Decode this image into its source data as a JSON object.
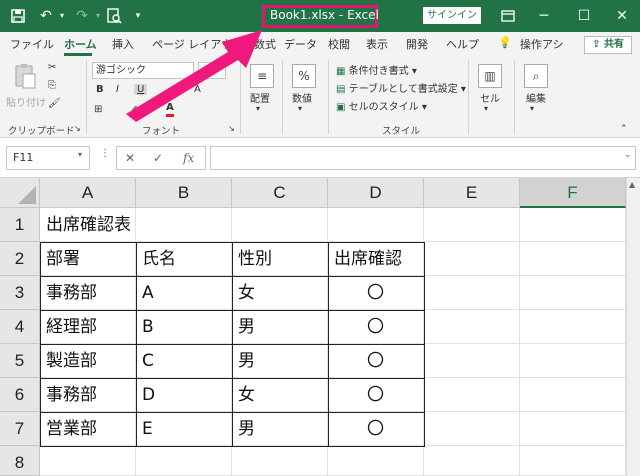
{
  "title_bar": {
    "document_title": "Book1.xlsx  -  Excel",
    "signin_label": "サインイン",
    "icons": [
      "save-icon",
      "undo-icon",
      "redo-icon",
      "print-preview-icon",
      "customize-icon",
      "ribbon-display-icon",
      "minimize-icon",
      "maximize-icon",
      "close-icon"
    ]
  },
  "ribbon_tabs": [
    "ファイル",
    "ホーム",
    "挿入",
    "ページ レイアウト",
    "数式",
    "データ",
    "校閲",
    "表示",
    "開発",
    "ヘルプ",
    "操作アシ"
  ],
  "share_label": "共有",
  "ribbon": {
    "clipboard": {
      "paste_label": "貼り付け",
      "group_label": "クリップボード"
    },
    "font": {
      "font_name": "游ゴシック",
      "font_size": "",
      "bold": "B",
      "italic": "I",
      "underline": "U",
      "font_color": "A",
      "group_label": "フォント"
    },
    "alignment": {
      "label": "配置"
    },
    "number": {
      "label": "数値"
    },
    "styles": {
      "items": [
        "条件付き書式",
        "テーブルとして書式設定",
        "セルのスタイル"
      ],
      "group_label": "スタイル"
    },
    "cells": {
      "label": "セル"
    },
    "editing": {
      "label": "編集"
    }
  },
  "formula_bar": {
    "name_box": "F11",
    "formula": ""
  },
  "grid": {
    "columns": [
      "A",
      "B",
      "C",
      "D",
      "E",
      "F"
    ],
    "rows": [
      "1",
      "2",
      "3",
      "4",
      "5",
      "6",
      "7",
      "8"
    ],
    "cells": {
      "A1": "出席確認表",
      "A2": "部署",
      "B2": "氏名",
      "C2": "性別",
      "D2": "出席確認",
      "A3": "事務部",
      "B3": "A",
      "C3": "女",
      "D3": "〇",
      "A4": "経理部",
      "B4": "B",
      "C4": "男",
      "D4": "〇",
      "A5": "製造部",
      "B5": "C",
      "C5": "男",
      "D5": "〇",
      "A6": "事務部",
      "B6": "D",
      "C6": "女",
      "D6": "〇",
      "A7": "営業部",
      "B7": "E",
      "C7": "男",
      "D7": "〇"
    }
  },
  "colors": {
    "excel_green": "#217346",
    "highlight_pink": "#e0186c"
  }
}
